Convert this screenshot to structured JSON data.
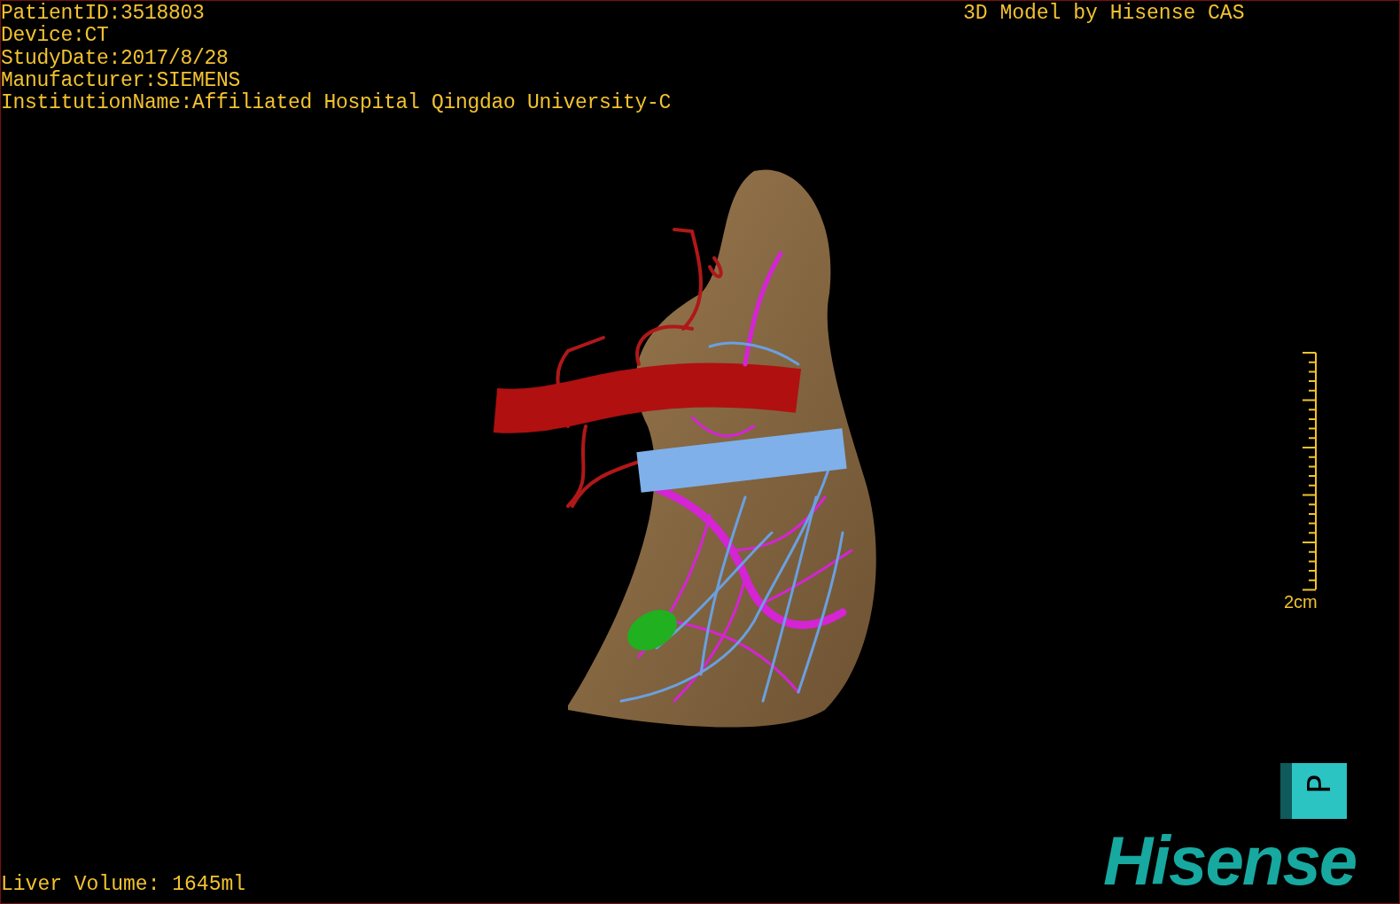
{
  "patient_info": [
    "PatientID:3518803",
    "Device:CT",
    "StudyDate:2017/8/28",
    "Manufacturer:SIEMENS",
    "InstitutionName:Affiliated Hospital Qingdao University-C"
  ],
  "model_credit": "3D Model by Hisense CAS",
  "scale_bar": {
    "label": "2cm"
  },
  "orientation_cube": {
    "label": "P"
  },
  "liver_volume": "Liver Volume: 1645ml",
  "logo": "Hisense"
}
